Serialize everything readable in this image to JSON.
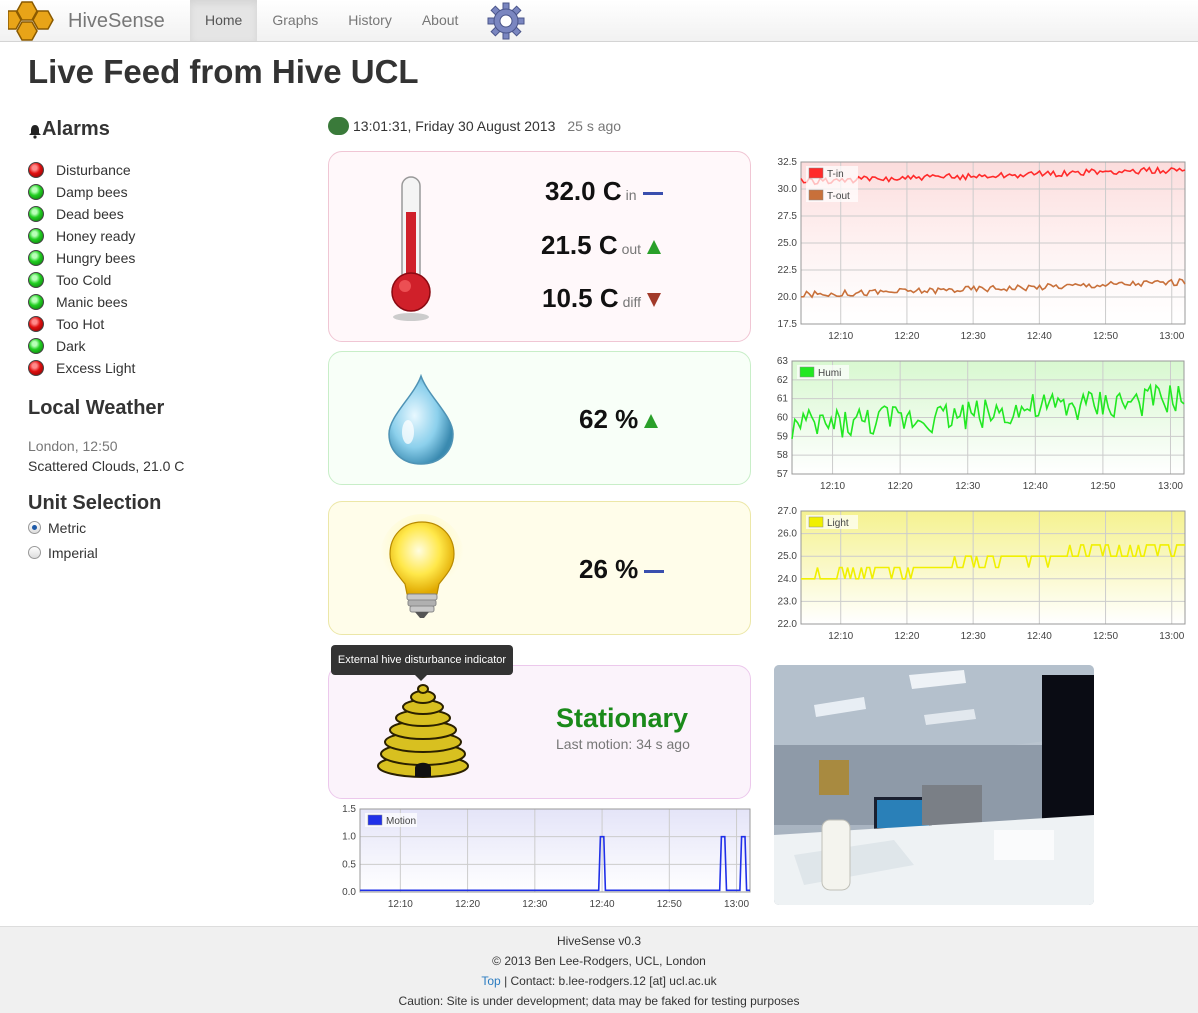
{
  "nav": {
    "brand": "HiveSense",
    "items": [
      "Home",
      "Graphs",
      "History",
      "About"
    ],
    "active": "Home"
  },
  "page": {
    "title": "Live Feed from Hive UCL"
  },
  "sidebar": {
    "alarms_title": "Alarms",
    "alarms": [
      {
        "label": "Disturbance",
        "state": "red"
      },
      {
        "label": "Damp bees",
        "state": "green"
      },
      {
        "label": "Dead bees",
        "state": "green"
      },
      {
        "label": "Honey ready",
        "state": "green"
      },
      {
        "label": "Hungry bees",
        "state": "green"
      },
      {
        "label": "Too Cold",
        "state": "green"
      },
      {
        "label": "Manic bees",
        "state": "green"
      },
      {
        "label": "Too Hot",
        "state": "red"
      },
      {
        "label": "Dark",
        "state": "green"
      },
      {
        "label": "Excess Light",
        "state": "red"
      }
    ],
    "weather_title": "Local Weather",
    "weather_place": "London, 12:50",
    "weather_conditions": "Scattered Clouds, 21.0 C",
    "unit_title": "Unit Selection",
    "units": [
      {
        "label": "Metric",
        "selected": true
      },
      {
        "label": "Imperial",
        "selected": false
      }
    ]
  },
  "status": {
    "time": "13:01:31, Friday 30 August 2013",
    "ago": "25 s ago",
    "color": "#3a7a3a"
  },
  "readings": {
    "temp_in": {
      "value": "32.0 C",
      "suffix": "in",
      "trend": "flat"
    },
    "temp_out": {
      "value": "21.5 C",
      "suffix": "out",
      "trend": "up"
    },
    "temp_diff": {
      "value": "10.5 C",
      "suffix": "diff",
      "trend": "down"
    },
    "humidity": {
      "value": "62 %",
      "trend": "up"
    },
    "light": {
      "value": "26 %",
      "trend": "flat"
    }
  },
  "motion": {
    "state": "Stationary",
    "last_motion": "Last motion: 34 s ago",
    "tooltip": "External hive disturbance indicator"
  },
  "chart_data": [
    {
      "type": "line",
      "id": "temperature",
      "x": [
        "12:10",
        "12:20",
        "12:30",
        "12:40",
        "12:50",
        "13:00"
      ],
      "yticks": [
        "17.5",
        "20.0",
        "22.5",
        "25.0",
        "27.5",
        "30.0",
        "32.5"
      ],
      "ylim": [
        17.5,
        32.5
      ],
      "series": [
        {
          "name": "T-in",
          "color": "#ff2a2a",
          "start": 30.7,
          "end": 31.8
        },
        {
          "name": "T-out",
          "color": "#c8703a",
          "start": 20.2,
          "end": 21.4
        }
      ],
      "background": "#fcdcdc"
    },
    {
      "type": "line",
      "id": "humidity",
      "x": [
        "12:10",
        "12:20",
        "12:30",
        "12:40",
        "12:50",
        "13:00"
      ],
      "yticks": [
        "57",
        "58",
        "59",
        "60",
        "61",
        "62",
        "63"
      ],
      "ylim": [
        57,
        63
      ],
      "series": [
        {
          "name": "Humi",
          "color": "#22e822",
          "start": 59.5,
          "end": 61.0
        }
      ],
      "background": "#d8f8d0"
    },
    {
      "type": "line",
      "id": "light",
      "x": [
        "12:10",
        "12:20",
        "12:30",
        "12:40",
        "12:50",
        "13:00"
      ],
      "yticks": [
        "22.0",
        "23.0",
        "24.0",
        "25.0",
        "26.0",
        "27.0"
      ],
      "ylim": [
        22.0,
        27.0
      ],
      "series": [
        {
          "name": "Light",
          "color": "#f0f000",
          "start": 24.0,
          "end": 25.5
        }
      ],
      "background": "#f5f290"
    },
    {
      "type": "line",
      "id": "motion",
      "x": [
        "12:10",
        "12:20",
        "12:30",
        "12:40",
        "12:50",
        "13:00"
      ],
      "yticks": [
        "0.0",
        "0.5",
        "1.0",
        "1.5"
      ],
      "ylim": [
        0,
        1.5
      ],
      "series": [
        {
          "name": "Motion",
          "color": "#2030e8",
          "spikes": [
            "12:40",
            "12:58",
            "13:01"
          ]
        }
      ],
      "background": "#e4e4f8"
    }
  ],
  "footer": {
    "version": "HiveSense v0.3",
    "copyright": "© 2013 Ben Lee-Rodgers, UCL, London",
    "top_link": "Top",
    "contact": "| Contact: b.lee-rodgers.12 [at] ucl.ac.uk",
    "caution": "Caution: Site is under development; data may be faked for testing purposes"
  }
}
